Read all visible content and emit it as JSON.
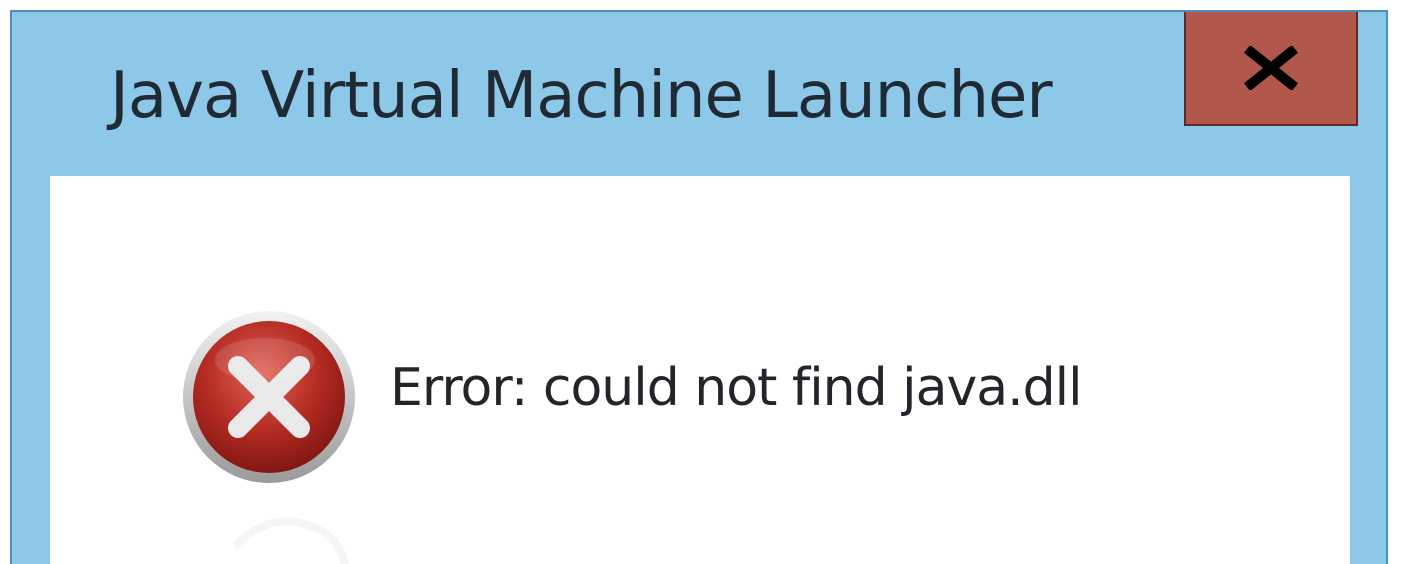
{
  "window": {
    "title": "Java Virtual Machine Launcher",
    "close_label": "x",
    "frame_color": "#8ec8e8",
    "close_color": "#b2574c"
  },
  "dialog": {
    "icon": "error-icon",
    "message": "Error: could not find java.dll"
  }
}
